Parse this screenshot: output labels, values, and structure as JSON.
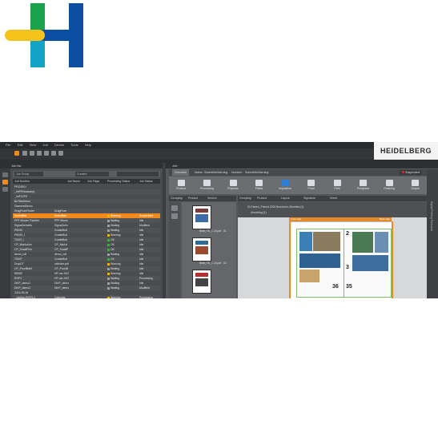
{
  "logo": {
    "colors": {
      "blue": "#0b4ea2",
      "green": "#1aa34a",
      "teal": "#12a3c7",
      "yellow": "#f6c21c"
    }
  },
  "menu": [
    "File",
    "Edit",
    "View",
    "Job",
    "Device",
    "Tools",
    "Help"
  ],
  "brand": "HEIDELBERG",
  "left_panel": {
    "title": "Job list",
    "filter_label": "Job Group",
    "filter_value": "Created",
    "columns": [
      "Job Number",
      "Job Name",
      "Job Flags",
      "Processing Status",
      "Job Status"
    ],
    "rows": [
      {
        "num": "PROJEKI",
        "name": "",
        "flags": "",
        "proc": "",
        "status": "",
        "sel": false
      },
      {
        "num": "_ImPPrinsavanp",
        "name": "",
        "flags": "",
        "proc": "",
        "status": "",
        "sel": false
      },
      {
        "num": "_ImPZ2FE",
        "name": "",
        "flags": "",
        "proc": "",
        "status": "",
        "sel": false
      },
      {
        "num": "BoTfanDemo",
        "name": "",
        "flags": "",
        "proc": "",
        "status": "",
        "sel": false
      },
      {
        "num": "DiamondDemo",
        "name": "",
        "flags": "",
        "proc": "",
        "status": "",
        "sel": false
      },
      {
        "num": "DragFromFinder",
        "name": "DragFrom",
        "flags": "",
        "proc": "",
        "status": "",
        "sel": false
      },
      {
        "num": "SubmitMe",
        "name": "SubmitMe",
        "flags": "",
        "proc": "Warning",
        "status": "Suspended",
        "sel": true
      },
      {
        "num": "PPF Mower Thumbn",
        "name": "PPF Mowe",
        "flags": "",
        "proc": "Waiting",
        "status": "Idle",
        "sel": false
      },
      {
        "num": "SignaOnlineIts",
        "name": "SignaOnlin",
        "flags": "",
        "proc": "Waiting",
        "status": "Modified",
        "sel": false
      },
      {
        "num": "PB020",
        "name": "CreateBuil",
        "flags": "",
        "proc": "Waiting",
        "status": "Idle",
        "sel": false
      },
      {
        "num": "PB020_t",
        "name": "CreateBuil",
        "flags": "",
        "proc": "Warning",
        "status": "Idle",
        "sel": false
      },
      {
        "num": "T0007_t",
        "name": "CreateBuil",
        "flags": "",
        "proc": "OK",
        "status": "Idle",
        "sel": false
      },
      {
        "num": "CP_IMaAction",
        "name": "CP_MaAct",
        "flags": "",
        "proc": "OK",
        "status": "Idle",
        "sel": false
      },
      {
        "num": "CP_SmallPrev",
        "name": "CP_SmallP",
        "flags": "",
        "proc": "OK",
        "status": "Idle",
        "sel": false
      },
      {
        "num": "demo_rolf",
        "name": "demo_rolf",
        "flags": "",
        "proc": "Waiting",
        "status": "Idle",
        "sel": false
      },
      {
        "num": "T0007",
        "name": "CreateBuil",
        "flags": "",
        "proc": "OK",
        "status": "Idle",
        "sel": false
      },
      {
        "num": "DropDT",
        "name": "mkfnder.pdf",
        "flags": "",
        "proc": "Warning",
        "status": "Idle",
        "sel": false
      },
      {
        "num": "CP_ProofBrief",
        "name": "CP_ProofB",
        "flags": "",
        "proc": "Waiting",
        "status": "Idle",
        "sel": false
      },
      {
        "num": "RB020",
        "name": "HP-usr-HAT",
        "flags": "",
        "proc": "Warning",
        "status": "Idle",
        "sel": false
      },
      {
        "num": "RHP1",
        "name": "HP-usr-HAT",
        "flags": "",
        "proc": "Waiting",
        "status": "Processing",
        "sel": false
      },
      {
        "num": "DiKP_demo1",
        "name": "DiKP_demo",
        "flags": "",
        "proc": "Waiting",
        "status": "Idle",
        "sel": false
      },
      {
        "num": "DiKP_demo2",
        "name": "DiKP_demo",
        "flags": "",
        "proc": "Waiting",
        "status": "Modified",
        "sel": false
      },
      {
        "num": "2016-05-06",
        "name": "",
        "flags": "",
        "proc": "",
        "status": "",
        "sel": false
      },
      {
        "num": "_JobMgr.PrjPFL2",
        "name": "Calendar",
        "flags": "",
        "proc": "Warning",
        "status": "Processing",
        "sel": false
      }
    ]
  },
  "right_panel": {
    "title": "Job",
    "tab_overview": "Overview",
    "name_label": "Name:",
    "name_value": "SubmitMeWarning",
    "number_label": "Number:",
    "number_value": "SubmitMeWarning",
    "suspended": "Suspended",
    "steps": [
      "Product",
      "Processing",
      "Prepress",
      "Plates",
      "Imposition",
      "Proof",
      "Print",
      "Postpress",
      "Finishing",
      "Output"
    ],
    "popup": [
      "N3424_Kalander_HD_Suparmitter",
      "Indet_1006 (Impo)"
    ],
    "gbar_left": {
      "grouping": "Grouping:",
      "product": "Product",
      "version": "Version"
    },
    "gbar_right": {
      "grouping": "Grouping:",
      "product": "Product",
      "layout": "Layout",
      "signature": "Signature",
      "sheet": "Sheet"
    },
    "tree": [
      "03-Falzen_Primed 2000 Broschüre-Sheetfed (2)",
      "Umschlag (1)"
    ],
    "thumbs": [
      "Blatt_HD_1-10.pdf - 01",
      "Blatt_HD_1-10.pdf - 02"
    ],
    "sheet_head_left": "Front side",
    "sheet_head_right": "Back side",
    "page_numbers": [
      "2",
      "3",
      "36",
      "35"
    ],
    "side_strip": "Digital Printing Technical"
  }
}
